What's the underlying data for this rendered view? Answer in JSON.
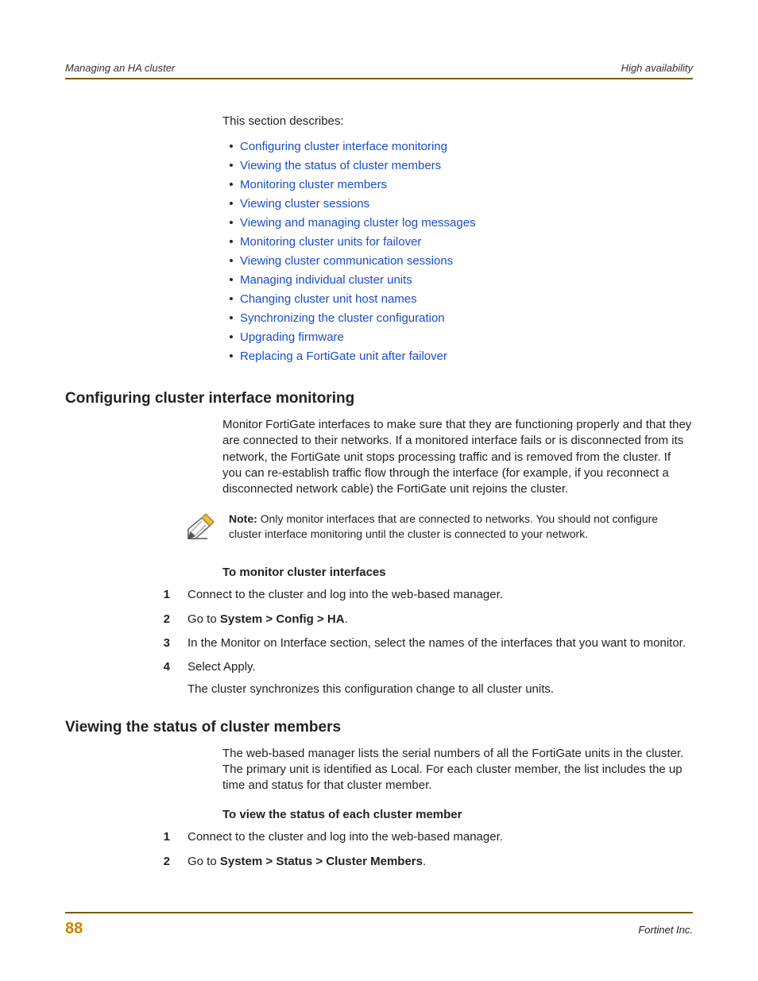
{
  "header": {
    "left": "Managing an HA cluster",
    "right": "High availability"
  },
  "intro": "This section describes:",
  "links": [
    "Configuring cluster interface monitoring",
    "Viewing the status of cluster members",
    "Monitoring cluster members",
    "Viewing cluster sessions",
    "Viewing and managing cluster log messages",
    "Monitoring cluster units for failover",
    "Viewing cluster communication sessions",
    "Managing individual cluster units",
    "Changing cluster unit host names",
    "Synchronizing the cluster configuration",
    "Upgrading firmware",
    "Replacing a FortiGate unit after failover"
  ],
  "section1": {
    "title": "Configuring cluster interface monitoring",
    "para": "Monitor FortiGate interfaces to make sure that they are functioning properly and that they are connected to their networks. If a monitored interface fails or is disconnected from its network, the FortiGate unit stops processing traffic and is removed from the cluster. If you can re-establish traffic flow through the interface (for example, if you reconnect a disconnected network cable) the FortiGate unit rejoins the cluster.",
    "note_label": "Note:",
    "note_text": " Only monitor interfaces that are connected to networks. You should not configure cluster interface monitoring until the cluster is connected to your network.",
    "subhead": "To monitor cluster interfaces",
    "steps": [
      {
        "n": "1",
        "pre": "Connect to the cluster and log into the web-based manager.",
        "bold": "",
        "post": ""
      },
      {
        "n": "2",
        "pre": "Go to ",
        "bold": "System > Config > HA",
        "post": "."
      },
      {
        "n": "3",
        "pre": "In the Monitor on Interface section, select the names of the interfaces that you want to monitor.",
        "bold": "",
        "post": ""
      },
      {
        "n": "4",
        "pre": "Select Apply.",
        "bold": "",
        "post": "",
        "extra": "The cluster synchronizes this configuration change to all cluster units."
      }
    ]
  },
  "section2": {
    "title": "Viewing the status of cluster members",
    "para": "The web-based manager lists the serial numbers of all the FortiGate units in the cluster. The primary unit is identified as Local. For each cluster member, the list includes the up time and status for that cluster member.",
    "subhead": "To view the status of each cluster member",
    "steps": [
      {
        "n": "1",
        "pre": "Connect to the cluster and log into the web-based manager.",
        "bold": "",
        "post": ""
      },
      {
        "n": "2",
        "pre": "Go to ",
        "bold": "System > Status > Cluster Members",
        "post": "."
      }
    ]
  },
  "footer": {
    "page": "88",
    "company": "Fortinet Inc."
  }
}
